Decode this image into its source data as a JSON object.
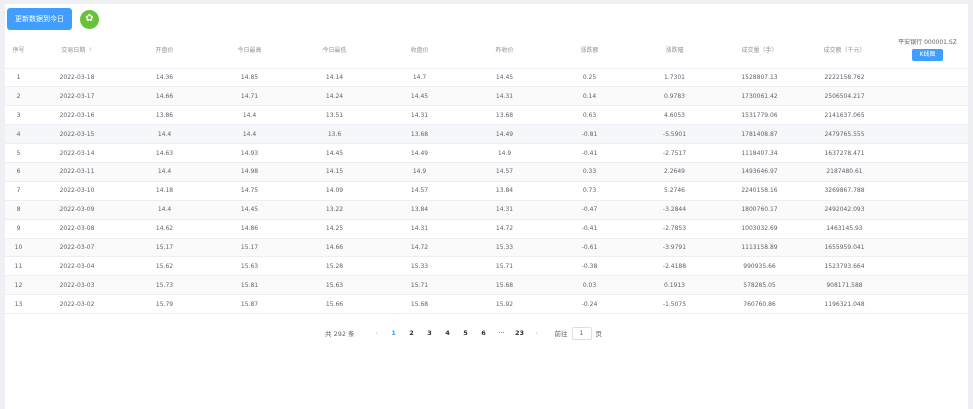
{
  "toolbar": {
    "update_label": "更新数据到今日",
    "star_glyph": "✿"
  },
  "table": {
    "headers": [
      "序号",
      "交易日期",
      "开盘价",
      "今日最高",
      "今日最低",
      "收盘价",
      "昨收价",
      "涨跌额",
      "涨跌幅",
      "成交量（手）",
      "成交额（千元）"
    ],
    "stock_name": "平安银行 000001.SZ",
    "kline_label": "K线图",
    "rows": [
      [
        "1",
        "2022-03-18",
        "14.36",
        "14.85",
        "14.14",
        "14.7",
        "14.45",
        "0.25",
        "1.7301",
        "1528807.13",
        "2222158.762"
      ],
      [
        "2",
        "2022-03-17",
        "14.66",
        "14.71",
        "14.24",
        "14.45",
        "14.31",
        "0.14",
        "0.9783",
        "1730061.42",
        "2506504.217"
      ],
      [
        "3",
        "2022-03-16",
        "13.86",
        "14.4",
        "13.51",
        "14.31",
        "13.68",
        "0.63",
        "4.6053",
        "1531779.06",
        "2141637.065"
      ],
      [
        "4",
        "2022-03-15",
        "14.4",
        "14.4",
        "13.6",
        "13.68",
        "14.49",
        "-0.81",
        "-5.5901",
        "1781408.87",
        "2479765.555"
      ],
      [
        "5",
        "2022-03-14",
        "14.63",
        "14.93",
        "14.45",
        "14.49",
        "14.9",
        "-0.41",
        "-2.7517",
        "1118407.34",
        "1637278.471"
      ],
      [
        "6",
        "2022-03-11",
        "14.4",
        "14.98",
        "14.15",
        "14.9",
        "14.57",
        "0.33",
        "2.2649",
        "1493646.97",
        "2187480.61"
      ],
      [
        "7",
        "2022-03-10",
        "14.18",
        "14.75",
        "14.09",
        "14.57",
        "13.84",
        "0.73",
        "5.2746",
        "2240158.16",
        "3269867.788"
      ],
      [
        "8",
        "2022-03-09",
        "14.4",
        "14.45",
        "13.22",
        "13.84",
        "14.31",
        "-0.47",
        "-3.2844",
        "1800760.17",
        "2492042.093"
      ],
      [
        "9",
        "2022-03-08",
        "14.62",
        "14.86",
        "14.25",
        "14.31",
        "14.72",
        "-0.41",
        "-2.7853",
        "1003032.69",
        "1463145.93"
      ],
      [
        "10",
        "2022-03-07",
        "15.17",
        "15.17",
        "14.66",
        "14.72",
        "15.33",
        "-0.61",
        "-3.9791",
        "1113158.89",
        "1655959.041"
      ],
      [
        "11",
        "2022-03-04",
        "15.62",
        "15.63",
        "15.28",
        "15.33",
        "15.71",
        "-0.38",
        "-2.4188",
        "990935.66",
        "1523793.664"
      ],
      [
        "12",
        "2022-03-03",
        "15.73",
        "15.81",
        "15.63",
        "15.71",
        "15.68",
        "0.03",
        "0.1913",
        "578285.05",
        "908171.588"
      ],
      [
        "13",
        "2022-03-02",
        "15.79",
        "15.87",
        "15.66",
        "15.68",
        "15.92",
        "-0.24",
        "-1.5075",
        "760760.86",
        "1196321.048"
      ]
    ]
  },
  "pagination": {
    "total_label": "共 292 条",
    "prev_glyph": "‹",
    "next_glyph": "›",
    "pages": [
      "1",
      "2",
      "3",
      "4",
      "5",
      "6"
    ],
    "ellipsis": "···",
    "last_page": "23",
    "jump_prefix": "前往",
    "jump_value": "1",
    "jump_suffix": "页"
  }
}
